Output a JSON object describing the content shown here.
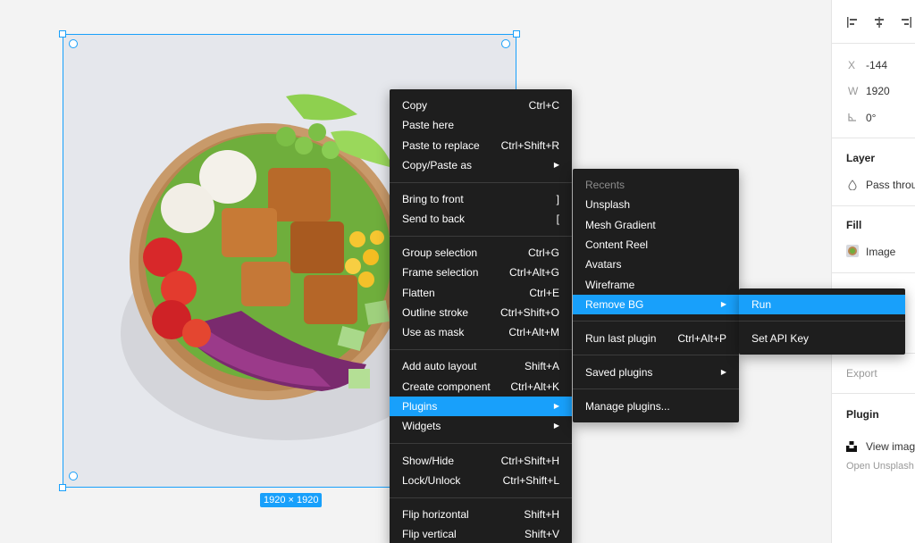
{
  "canvas": {
    "size_badge": "1920 × 1920"
  },
  "right_panel": {
    "x_label": "X",
    "x_value": "-144",
    "w_label": "W",
    "w_value": "1920",
    "rotation_value": "0°",
    "layer_title": "Layer",
    "layer_blend": "Pass throu",
    "fill_title": "Fill",
    "fill_value": "Image",
    "export_title": "Export",
    "plugin_title": "Plugin",
    "plugin_item": "View imag",
    "plugin_sub": "Open Unsplash"
  },
  "context_menu": {
    "items": [
      {
        "label": "Copy",
        "shortcut": "Ctrl+C"
      },
      {
        "label": "Paste here",
        "shortcut": ""
      },
      {
        "label": "Paste to replace",
        "shortcut": "Ctrl+Shift+R"
      },
      {
        "label": "Copy/Paste as",
        "shortcut": "▶"
      },
      {
        "label": "Bring to front",
        "shortcut": "]"
      },
      {
        "label": "Send to back",
        "shortcut": "["
      },
      {
        "label": "Group selection",
        "shortcut": "Ctrl+G"
      },
      {
        "label": "Frame selection",
        "shortcut": "Ctrl+Alt+G"
      },
      {
        "label": "Flatten",
        "shortcut": "Ctrl+E"
      },
      {
        "label": "Outline stroke",
        "shortcut": "Ctrl+Shift+O"
      },
      {
        "label": "Use as mask",
        "shortcut": "Ctrl+Alt+M"
      },
      {
        "label": "Add auto layout",
        "shortcut": "Shift+A"
      },
      {
        "label": "Create component",
        "shortcut": "Ctrl+Alt+K"
      },
      {
        "label": "Plugins",
        "shortcut": "▶"
      },
      {
        "label": "Widgets",
        "shortcut": "▶"
      },
      {
        "label": "Show/Hide",
        "shortcut": "Ctrl+Shift+H"
      },
      {
        "label": "Lock/Unlock",
        "shortcut": "Ctrl+Shift+L"
      },
      {
        "label": "Flip horizontal",
        "shortcut": "Shift+H"
      },
      {
        "label": "Flip vertical",
        "shortcut": "Shift+V"
      }
    ]
  },
  "plugins_menu": {
    "items": [
      {
        "label": "Recents",
        "shortcut": ""
      },
      {
        "label": "Unsplash",
        "shortcut": ""
      },
      {
        "label": "Mesh Gradient",
        "shortcut": ""
      },
      {
        "label": "Content Reel",
        "shortcut": ""
      },
      {
        "label": "Avatars",
        "shortcut": ""
      },
      {
        "label": "Wireframe",
        "shortcut": ""
      },
      {
        "label": "Remove BG",
        "shortcut": "▶"
      },
      {
        "label": "Run last plugin",
        "shortcut": "Ctrl+Alt+P"
      },
      {
        "label": "Saved plugins",
        "shortcut": "▶"
      },
      {
        "label": "Manage plugins...",
        "shortcut": ""
      }
    ]
  },
  "removebg_menu": {
    "items": [
      {
        "label": "Run"
      },
      {
        "label": "Set API Key"
      }
    ]
  },
  "colors": {
    "accent": "#18a0fb",
    "menu_bg": "#1e1e1e"
  }
}
